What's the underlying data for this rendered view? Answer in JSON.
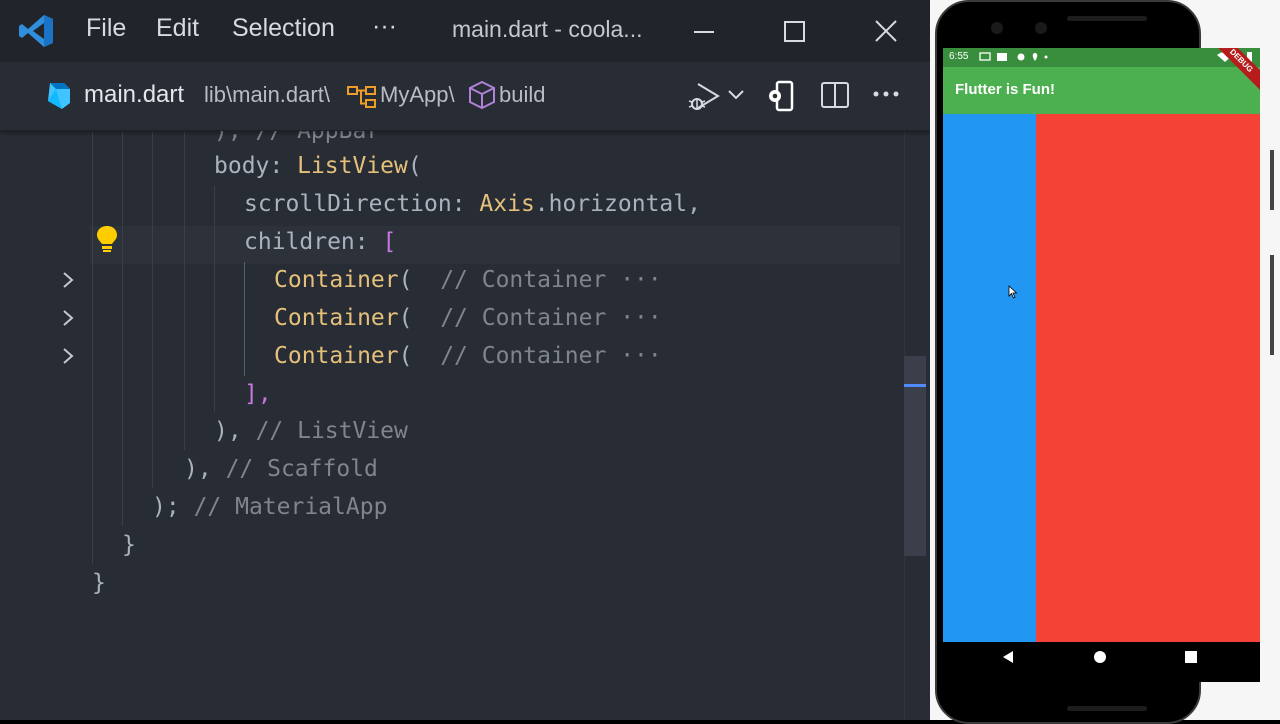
{
  "titlebar": {
    "menu": [
      "File",
      "Edit",
      "Selection",
      "···"
    ],
    "window_title": "main.dart - coola..."
  },
  "breadcrumb": {
    "file": "main.dart",
    "path": "lib\\main.dart\\",
    "class_name": "MyApp\\",
    "method": "build"
  },
  "code": {
    "line0": "), // AppBar",
    "line1_key": "body: ",
    "line1_fn": "ListView",
    "line1_paren": "(",
    "line2_key": "scrollDirection: ",
    "line2_type": "Axis",
    "line2_rest": ".horizontal,",
    "line3_key": "children: ",
    "line3_bracket": "[",
    "container_fn": "Container",
    "container_paren": "(",
    "container_comment": "// Container ···",
    "line7": "],",
    "line8_code": "),",
    "line8_comment": "// ListView",
    "line9_code": "),",
    "line9_comment": "// Scaffold",
    "line10_code": ");",
    "line10_comment": "// MaterialApp",
    "line11": "}",
    "line12": "}"
  },
  "phone": {
    "status_time": "6:55",
    "app_title": "Flutter is Fun!",
    "debug_label": "DEBUG",
    "colors": {
      "appbar": "#4caf50",
      "statusbar": "#388e3c",
      "container_blue": "#2196f3",
      "container_red": "#f44336"
    }
  },
  "colors": {
    "editor_bg": "#282c34",
    "titlebar_bg": "#21252b",
    "function": "#e5c07b",
    "property": "#d19a66",
    "comment": "#7f848e",
    "punctuation": "#c678dd"
  },
  "icons": [
    "vscode-logo-icon",
    "minimize-icon",
    "maximize-icon",
    "close-icon",
    "dart-icon",
    "class-icon",
    "method-cube-icon",
    "run-debug-icon",
    "chevron-down-icon",
    "device-settings-icon",
    "split-editor-icon",
    "more-actions-icon",
    "lightbulb-icon",
    "fold-chevron-icon"
  ]
}
